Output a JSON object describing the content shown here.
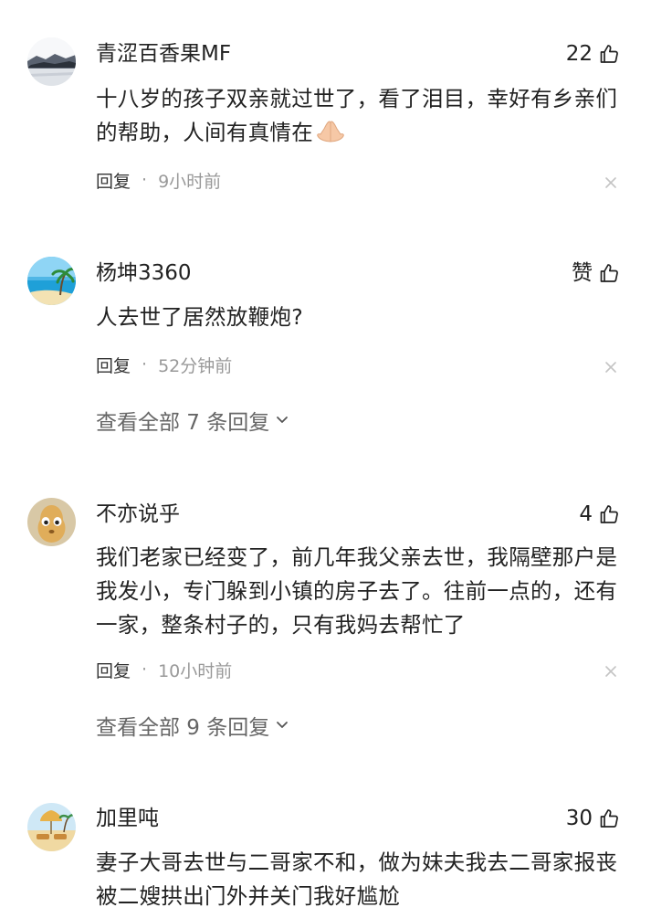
{
  "comments": [
    {
      "username": "青涩百香果MF",
      "likes": "22",
      "text": "十八岁的孩子双亲就过世了，看了泪目，幸好有乡亲们的帮助，人间有真情在",
      "reply_label": "回复",
      "dot": "·",
      "time": "9小时前"
    },
    {
      "username": "杨坤3360",
      "likes": "赞",
      "text": "人去世了居然放鞭炮?",
      "reply_label": "回复",
      "dot": "·",
      "time": "52分钟前",
      "view_replies": "查看全部 7 条回复"
    },
    {
      "username": "不亦说乎",
      "likes": "4",
      "text": "我们老家已经变了，前几年我父亲去世，我隔壁那户是我发小，专门躲到小镇的房子去了。往前一点的，还有一家，整条村子的，只有我妈去帮忙了",
      "reply_label": "回复",
      "dot": "·",
      "time": "10小时前",
      "view_replies": "查看全部 9 条回复"
    },
    {
      "username": "加里吨",
      "likes": "30",
      "text": "妻子大哥去世与二哥家不和，做为妹夫我去二哥家报丧被二嫂拱出门外并关门我好尴尬"
    }
  ],
  "icons": {
    "like": "thumbs-up-icon",
    "close": "close-icon",
    "chevron": "chevron-down-icon",
    "emoji": "folded-hands-emoji"
  },
  "colors": {
    "text": "#222222",
    "meta": "#999999",
    "link": "#666666"
  }
}
